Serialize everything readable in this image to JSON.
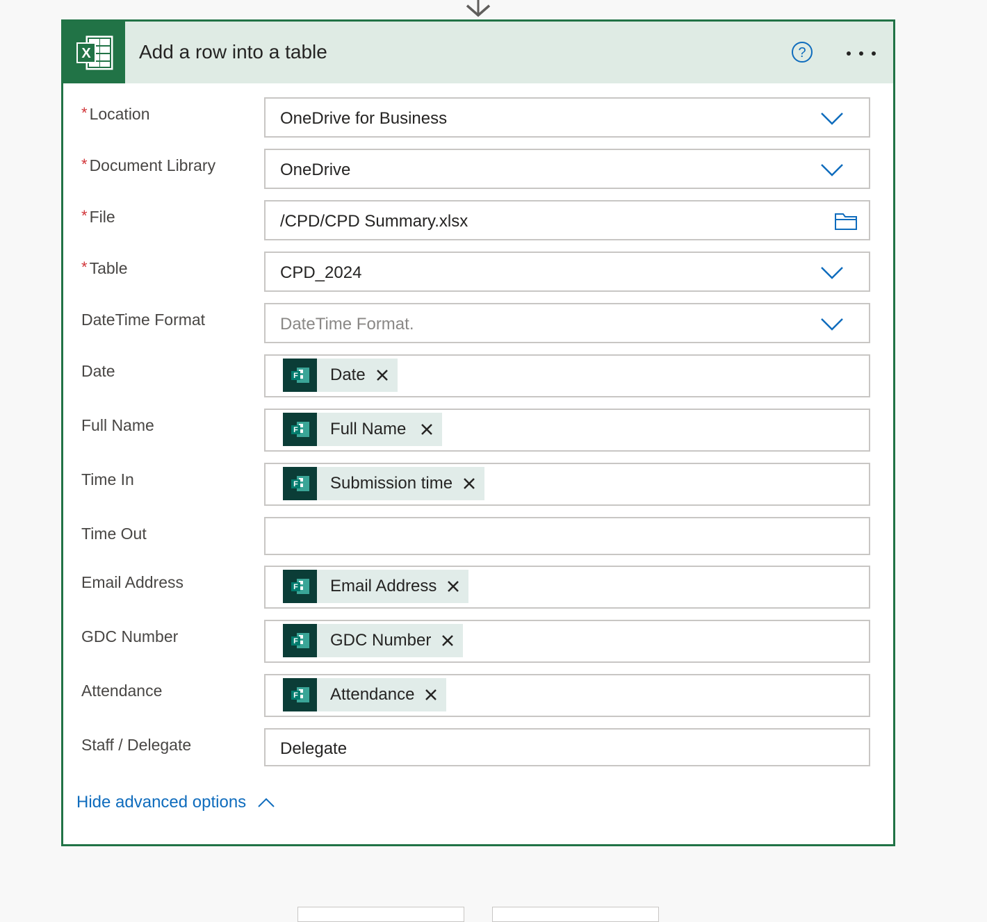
{
  "card": {
    "title": "Add a row into a table",
    "icon": "excel-icon",
    "help_icon": "help-icon",
    "more_icon": "more-options-icon"
  },
  "fields": {
    "location": {
      "label": "Location",
      "required": true,
      "value": "OneDrive for Business"
    },
    "document_library": {
      "label": "Document Library",
      "required": true,
      "value": "OneDrive"
    },
    "file": {
      "label": "File",
      "required": true,
      "value": "/CPD/CPD Summary.xlsx"
    },
    "table": {
      "label": "Table",
      "required": true,
      "value": "CPD_2024"
    },
    "datetime_format": {
      "label": "DateTime Format",
      "placeholder": "DateTime Format."
    },
    "date": {
      "label": "Date",
      "token": "Date"
    },
    "full_name": {
      "label": "Full Name",
      "token": "Full Name"
    },
    "time_in": {
      "label": "Time In",
      "token": "Submission time"
    },
    "time_out": {
      "label": "Time Out",
      "value": ""
    },
    "email_address": {
      "label": "Email Address",
      "token": "Email Address"
    },
    "gdc_number": {
      "label": "GDC Number",
      "token": "GDC Number"
    },
    "attendance": {
      "label": "Attendance",
      "token": "Attendance"
    },
    "staff_delegate": {
      "label": "Staff / Delegate",
      "value": "Delegate"
    }
  },
  "required_marker": "*",
  "advanced_options": {
    "label": "Hide advanced options"
  },
  "colors": {
    "excel_green": "#217346",
    "header_bg": "#dfebe4",
    "link_blue": "#0f6cbd",
    "token_bg": "#e1ece9",
    "forms_icon_bg": "#0b3d37",
    "required_red": "#d13438"
  }
}
